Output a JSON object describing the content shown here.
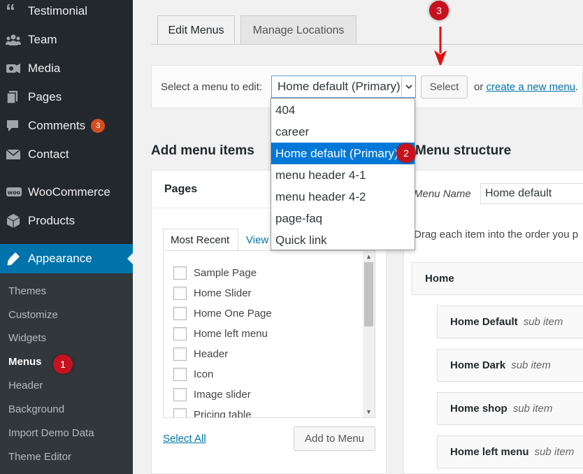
{
  "sidebar": {
    "items": [
      {
        "label": "Testimonial",
        "icon": "quote-icon"
      },
      {
        "label": "Team",
        "icon": "team-icon"
      },
      {
        "label": "Media",
        "icon": "media-icon"
      },
      {
        "label": "Pages",
        "icon": "pages-icon"
      },
      {
        "label": "Comments",
        "icon": "comment-icon",
        "badge": "3"
      },
      {
        "label": "Contact",
        "icon": "envelope-icon"
      },
      {
        "label": "WooCommerce",
        "icon": "woocommerce-icon"
      },
      {
        "label": "Products",
        "icon": "box-icon"
      }
    ],
    "appearance": {
      "label": "Appearance",
      "icon": "paintbrush-icon"
    },
    "submenu": [
      "Themes",
      "Customize",
      "Widgets",
      "Menus",
      "Header",
      "Background",
      "Import Demo Data",
      "Theme Editor"
    ]
  },
  "annotations": {
    "one": "1",
    "two": "2",
    "three": "3"
  },
  "tabs": {
    "edit": "Edit Menus",
    "manage": "Manage Locations"
  },
  "select_bar": {
    "label": "Select a menu to edit:",
    "selected": "Home default (Primary)",
    "button": "Select",
    "or": "or",
    "create_link": "create a new menu",
    "period": "."
  },
  "dropdown": {
    "options": [
      "404",
      "career",
      "Home default (Primary)",
      "menu header 4-1",
      "menu header 4-2",
      "page-faq",
      "Quick link"
    ],
    "selected_index": 2
  },
  "add_items": {
    "heading": "Add menu items",
    "pages_title": "Pages",
    "tab_recent": "Most Recent",
    "tab_view": "View",
    "pages": [
      "Sample Page",
      "Home Slider",
      "Home One Page",
      "Home left menu",
      "Header",
      "Icon",
      "Image slider",
      "Pricing table"
    ],
    "select_all": "Select All",
    "add_button": "Add to Menu"
  },
  "structure": {
    "heading": "Menu structure",
    "menu_name_label": "Menu Name",
    "menu_name_value": "Home default",
    "drag_text": "Drag each item into the order you p",
    "items": [
      {
        "title": "Home",
        "sub": ""
      },
      {
        "title": "Home Default",
        "sub": "sub item"
      },
      {
        "title": "Home Dark",
        "sub": "sub item"
      },
      {
        "title": "Home shop",
        "sub": "sub item"
      },
      {
        "title": "Home left menu",
        "sub": "sub item"
      }
    ]
  },
  "colors": {
    "accent": "#0073aa",
    "sidebar": "#23282d",
    "badge": "#d54e21",
    "annotation": "#c6111f"
  }
}
